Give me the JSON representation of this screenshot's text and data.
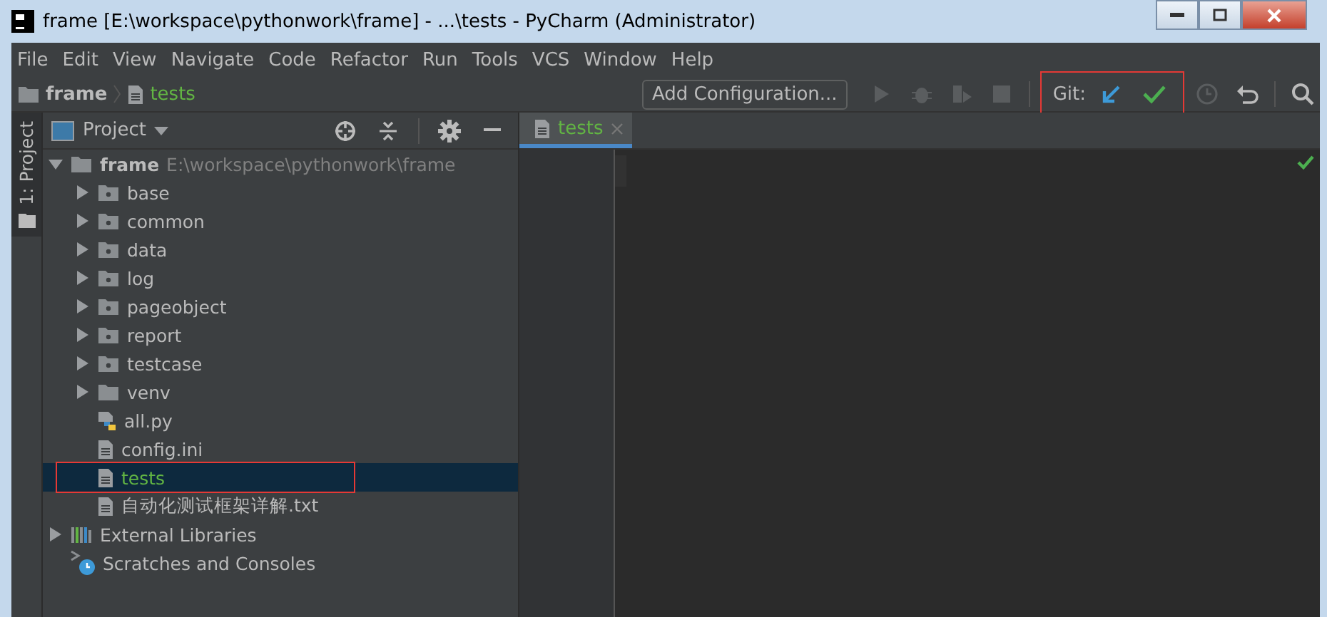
{
  "window": {
    "title": "frame [E:\\workspace\\pythonwork\\frame] - ...\\tests - PyCharm (Administrator)"
  },
  "menu": [
    "File",
    "Edit",
    "View",
    "Navigate",
    "Code",
    "Refactor",
    "Run",
    "Tools",
    "VCS",
    "Window",
    "Help"
  ],
  "breadcrumb": [
    {
      "label": "frame",
      "kind": "folder",
      "vcs_added": false
    },
    {
      "label": "tests",
      "kind": "file",
      "vcs_added": true
    }
  ],
  "toolbar": {
    "config_button": "Add Configuration...",
    "git_label": "Git:",
    "git_highlighted": true
  },
  "side_strip": {
    "label": "1: Project"
  },
  "project_panel": {
    "title": "Project"
  },
  "tree": [
    {
      "label": "frame",
      "path": "E:\\workspace\\pythonwork\\frame",
      "kind": "root",
      "expanded": true,
      "selected": false,
      "children": [
        {
          "label": "base",
          "kind": "package",
          "expanded": false,
          "selected": false
        },
        {
          "label": "common",
          "kind": "package",
          "expanded": false,
          "selected": false
        },
        {
          "label": "data",
          "kind": "package",
          "expanded": false,
          "selected": false
        },
        {
          "label": "log",
          "kind": "package",
          "expanded": false,
          "selected": false
        },
        {
          "label": "pageobject",
          "kind": "package",
          "expanded": false,
          "selected": false
        },
        {
          "label": "report",
          "kind": "package",
          "expanded": false,
          "selected": false
        },
        {
          "label": "testcase",
          "kind": "package",
          "expanded": false,
          "selected": false
        },
        {
          "label": "venv",
          "kind": "folder",
          "expanded": false,
          "selected": false
        },
        {
          "label": "all.py",
          "kind": "python",
          "selected": false,
          "vcs_added": false
        },
        {
          "label": "config.ini",
          "kind": "file",
          "selected": false,
          "vcs_added": false
        },
        {
          "label": "tests",
          "kind": "file",
          "selected": true,
          "vcs_added": true,
          "highlighted": true
        },
        {
          "label": "自动化测试框架详解.txt",
          "kind": "file",
          "selected": false,
          "vcs_added": false
        }
      ]
    },
    {
      "label": "External Libraries",
      "kind": "libraries",
      "expanded": false,
      "selected": false
    },
    {
      "label": "Scratches and Consoles",
      "kind": "scratches",
      "selected": false
    }
  ],
  "editor_tabs": [
    {
      "label": "tests",
      "selected": true,
      "vcs_added": true
    }
  ]
}
